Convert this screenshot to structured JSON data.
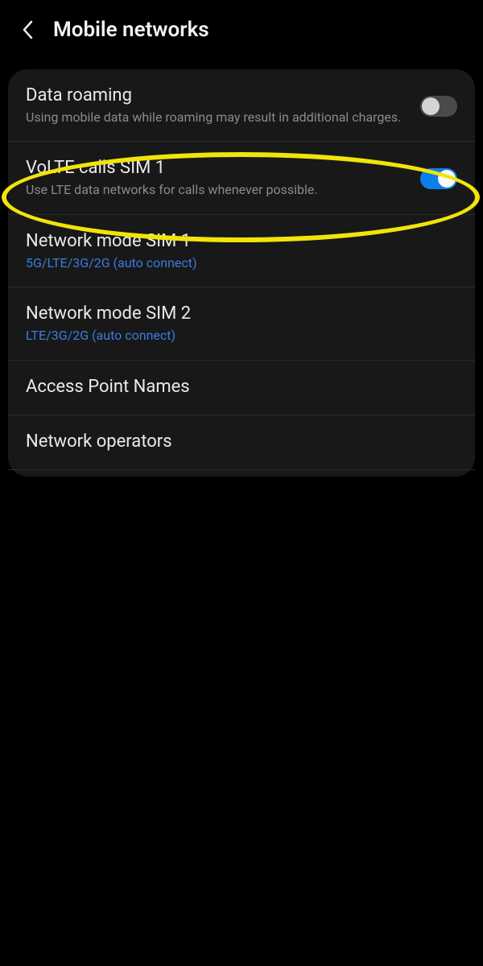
{
  "header": {
    "title": "Mobile networks"
  },
  "items": [
    {
      "title": "Data roaming",
      "sub": "Using mobile data while roaming may result in additional charges.",
      "subStyle": "gray",
      "toggle": "off"
    },
    {
      "title": "VoLTE calls SIM 1",
      "sub": "Use LTE data networks for calls whenever possible.",
      "subStyle": "gray",
      "toggle": "on"
    },
    {
      "title": "Network mode SIM 1",
      "sub": "5G/LTE/3G/2G (auto connect)",
      "subStyle": "blue"
    },
    {
      "title": "Network mode SIM 2",
      "sub": "LTE/3G/2G (auto connect)",
      "subStyle": "blue"
    },
    {
      "title": "Access Point Names"
    },
    {
      "title": "Network operators"
    }
  ]
}
